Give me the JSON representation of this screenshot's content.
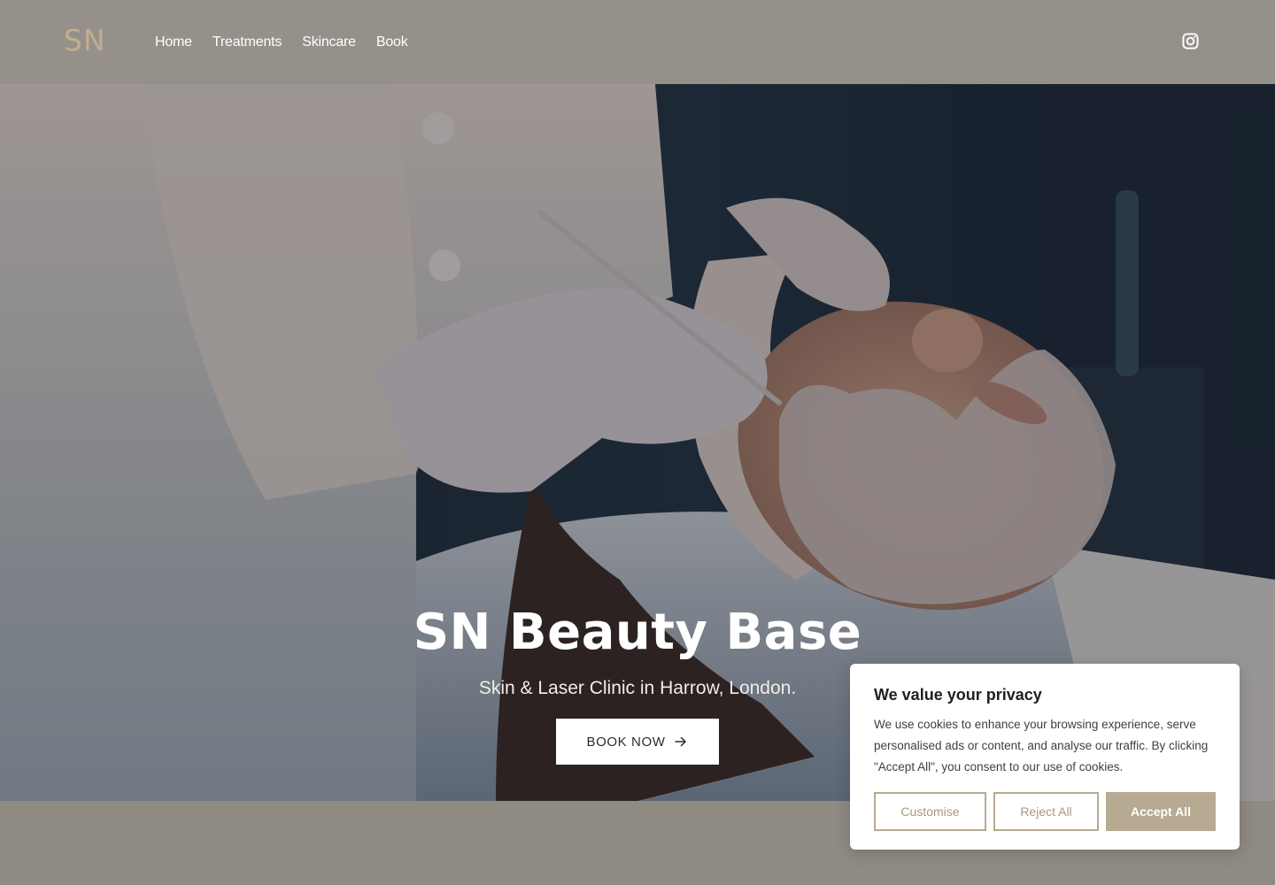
{
  "header": {
    "logo": "SN",
    "nav": [
      "Home",
      "Treatments",
      "Skincare",
      "Book"
    ],
    "social_icon": "instagram-icon"
  },
  "hero": {
    "title": "SN Beauty Base",
    "subtitle": "Skin & Laser Clinic in Harrow, London.",
    "cta_label": "BOOK NOW",
    "cta_icon": "arrow-right-icon",
    "image": "photo-facial-treatment"
  },
  "cookie": {
    "title": "We value your privacy",
    "text": "We use cookies to enhance your browsing experience, serve personalised ads or content, and analyse our traffic. By clicking \"Accept All\", you consent to our use of cookies.",
    "customise_label": "Customise",
    "reject_label": "Reject All",
    "accept_label": "Accept All"
  },
  "colors": {
    "header_bg": "#95918a",
    "page_bg": "#8f8b83",
    "logo": "#c3ad8e",
    "accent": "#b7aa92"
  }
}
